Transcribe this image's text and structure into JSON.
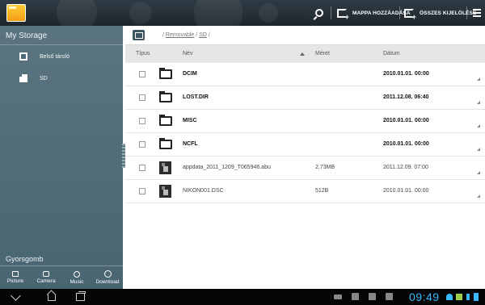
{
  "actionbar": {
    "add_folder_label": "MAPPA HOZZÁADÁSA",
    "select_all_label": "ÖSSZES KIJELÖLÉSE"
  },
  "sidebar": {
    "title": "My Storage",
    "items": [
      {
        "label": "Belső tároló",
        "icon": "internal-storage-icon"
      },
      {
        "label": "SD",
        "icon": "sd-card-icon"
      }
    ],
    "quick_title": "Gyorsgomb",
    "quick_items": [
      {
        "label": "Picture",
        "icon": "picture-icon"
      },
      {
        "label": "Camera",
        "icon": "camera-icon"
      },
      {
        "label": "Music",
        "icon": "music-icon"
      },
      {
        "label": "Download",
        "icon": "download-icon"
      }
    ]
  },
  "path": {
    "prefix": "/",
    "segments": [
      "Removable",
      "SD"
    ],
    "sep": "/"
  },
  "table": {
    "headers": {
      "type": "Típus",
      "name": "Név",
      "size": "Méret",
      "date": "Dátum"
    },
    "rows": [
      {
        "kind": "folder",
        "name": "DCIM",
        "size": "",
        "date": "2010.01.01. 00:00"
      },
      {
        "kind": "folder",
        "name": "LOST.DIR",
        "size": "",
        "date": "2011.12.08. 06:40"
      },
      {
        "kind": "folder",
        "name": "MISC",
        "size": "",
        "date": "2010.01.01. 00:00"
      },
      {
        "kind": "folder",
        "name": "NCFL",
        "size": "",
        "date": "2010.01.01. 00:00"
      },
      {
        "kind": "file",
        "name": "appdata_2011_1209_T065946.abu",
        "size": "2,73MB",
        "date": "2011.12.09. 07:00"
      },
      {
        "kind": "file",
        "name": "NIKON001.DSC",
        "size": "512B",
        "date": "2010.01.01. 00:00"
      }
    ]
  },
  "statusbar": {
    "clock": "09:49"
  },
  "colors": {
    "sidebar": "#536d79",
    "accent_clock": "#39b9ff",
    "topbar": "#27323a"
  }
}
